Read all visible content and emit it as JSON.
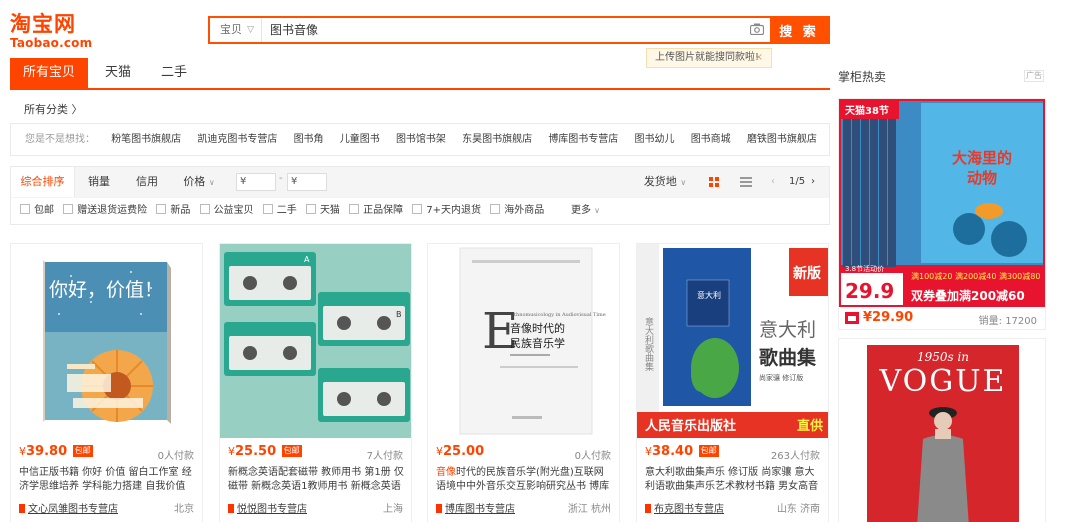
{
  "brand": {
    "cn": "淘宝网",
    "en": "Taobao.com"
  },
  "search": {
    "category": "宝贝",
    "query": "图书音像",
    "button": "搜 索"
  },
  "tooltip": {
    "text": "上传图片就能搜同款啦!",
    "close": "×"
  },
  "tabs": [
    {
      "label": "所有宝贝"
    },
    {
      "label": "天猫"
    },
    {
      "label": "二手"
    }
  ],
  "breadcrumb": "所有分类 〉",
  "suggest": {
    "label": "您是不是想找：",
    "items": [
      "粉笔图书旗舰店",
      "凯迪克图书专营店",
      "图书角",
      "儿童图书",
      "图书馆书架",
      "东昊图书旗舰店",
      "博库图书专营店",
      "图书幼儿",
      "图书商城",
      "磨铁图书旗舰店"
    ]
  },
  "sort": {
    "items": [
      "综合排序",
      "销量",
      "信用",
      "价格"
    ],
    "price_from": "¥",
    "price_to": "¥",
    "dash": "-",
    "ship_from": "发货地",
    "page": "1/5",
    "prev": "‹",
    "next": "›"
  },
  "filters": {
    "items": [
      "包邮",
      "赠送退货运费险",
      "新品",
      "公益宝贝",
      "二手",
      "天猫",
      "正品保障",
      "7+天内退货",
      "海外商品"
    ],
    "more": "更多"
  },
  "products": [
    {
      "currency": "¥",
      "price": "39.80",
      "tag": "包邮",
      "sold": "0人付款",
      "title_em": "",
      "title": "中信正版书籍 你好 价值 留白工作室 经济学思维培养 学科能力搭建 自我价值认同 文化",
      "shop": "文心凤雏图书专营店",
      "loc": "北京"
    },
    {
      "currency": "¥",
      "price": "25.50",
      "tag": "包邮",
      "sold": "7人付款",
      "title_em": "",
      "title": "新概念英语配套磁带 教师用书 第1册 仅磁带 新概念英语1教师用书 新概念英语教师用书",
      "shop": "悦悦图书专营店",
      "loc": "上海"
    },
    {
      "currency": "¥",
      "price": "25.00",
      "tag": "",
      "sold": "0人付款",
      "title_em": "音像",
      "title": "时代的民族音乐学(附光盘)互联网语境中中外音乐交互影响研究丛书 博库网",
      "shop": "博库图书专营店",
      "loc": "浙江 杭州"
    },
    {
      "currency": "¥",
      "price": "38.40",
      "tag": "包邮",
      "sold": "263人付款",
      "title_em": "",
      "title": "意大利歌曲集声乐 修订版 尚家骧 意大利语歌曲集声乐艺术教材书籍 男女高音教程声",
      "shop": "布克图书专营店",
      "loc": "山东 济南"
    }
  ],
  "covers": {
    "book1": {
      "title": "你好，价值！"
    },
    "book2": {
      "letter_a": "A",
      "letter_b": "B"
    },
    "book3": {
      "e": "E",
      "title1": "音像时代的",
      "title2": "民族音乐学",
      "en_title": "thnomusicology in Audiovisual Time"
    },
    "book4": {
      "badge": "新版",
      "title1": "意大利",
      "title2": "歌曲集",
      "sub": "尚家骧 修订版",
      "publisher": "人民音乐出版社",
      "direct": "直供",
      "spine": "意大利歌曲集"
    }
  },
  "sidebar": {
    "title": "掌柜热卖",
    "ad": "广告",
    "ad1": {
      "tmall_badge": "天猫38节",
      "book_title1": "大海里的",
      "book_title2": "动物",
      "event": "3.8节活动价",
      "promo_price": "29.9",
      "offer1": "满100减20 满200减40 满300减80",
      "offer2": "双券叠加满200减60",
      "currency": "¥",
      "price": "29.90",
      "sold": "销量: 17200"
    },
    "ad2": {
      "cover_small": "1950s in",
      "cover_big": "VOGUE"
    }
  },
  "colors": {
    "accent": "#ff4400",
    "search": "#ff5000",
    "tooltip_bg": "#fff8e6"
  }
}
